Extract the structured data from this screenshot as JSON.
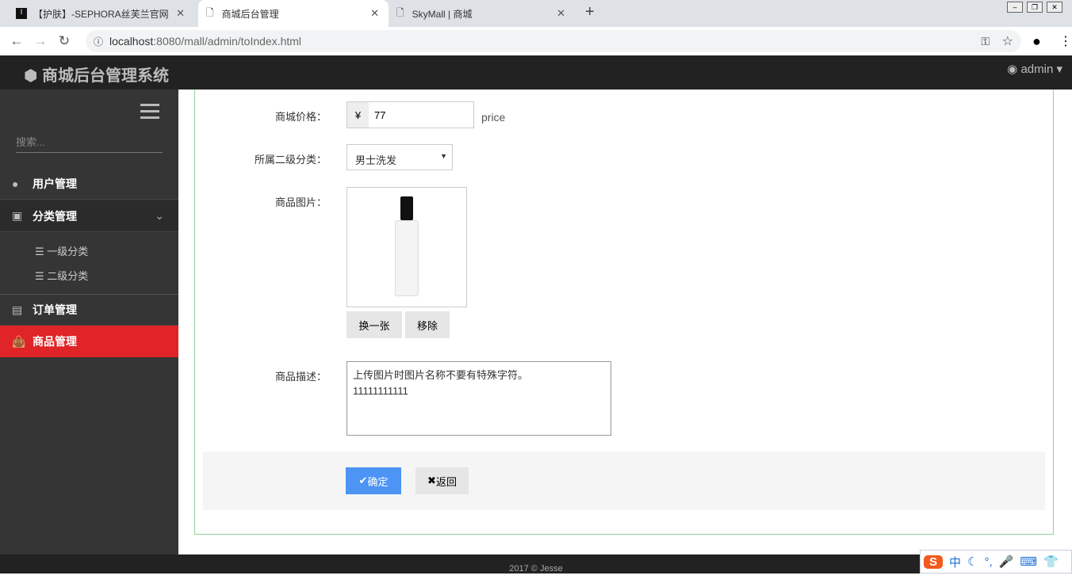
{
  "browser": {
    "tabs": [
      {
        "label": "【护肤】-SEPHORA丝芙兰官网"
      },
      {
        "label": "商城后台管理"
      },
      {
        "label": "SkyMall | 商城"
      }
    ],
    "url_host": "localhost",
    "url_rest": ":8080/mall/admin/toIndex.html"
  },
  "header": {
    "title": "商城后台管理系统",
    "user": "admin"
  },
  "sidebar": {
    "search_placeholder": "搜索...",
    "items": [
      {
        "label": "用户管理"
      },
      {
        "label": "分类管理"
      },
      {
        "label": "订单管理"
      },
      {
        "label": "商品管理"
      }
    ],
    "sub_items": [
      {
        "label": "一级分类"
      },
      {
        "label": "二级分类"
      }
    ]
  },
  "form": {
    "price_label": "商城价格：",
    "currency": "¥",
    "price_value": "77",
    "price_hint": "price",
    "category_label": "所属二级分类：",
    "category_value": "男士洗发",
    "image_label": "商品图片：",
    "change_image": "换一张",
    "remove_image": "移除",
    "desc_label": "商品描述：",
    "desc_value": "上传图片时图片名称不要有特殊字符。\n11111111111",
    "confirm": "确定",
    "back": "返回"
  },
  "footer": {
    "text": "2017 © Jesse"
  },
  "ime": {
    "mode": "中"
  },
  "colors": {
    "active": "#e02427",
    "primary": "#4d94f5"
  }
}
